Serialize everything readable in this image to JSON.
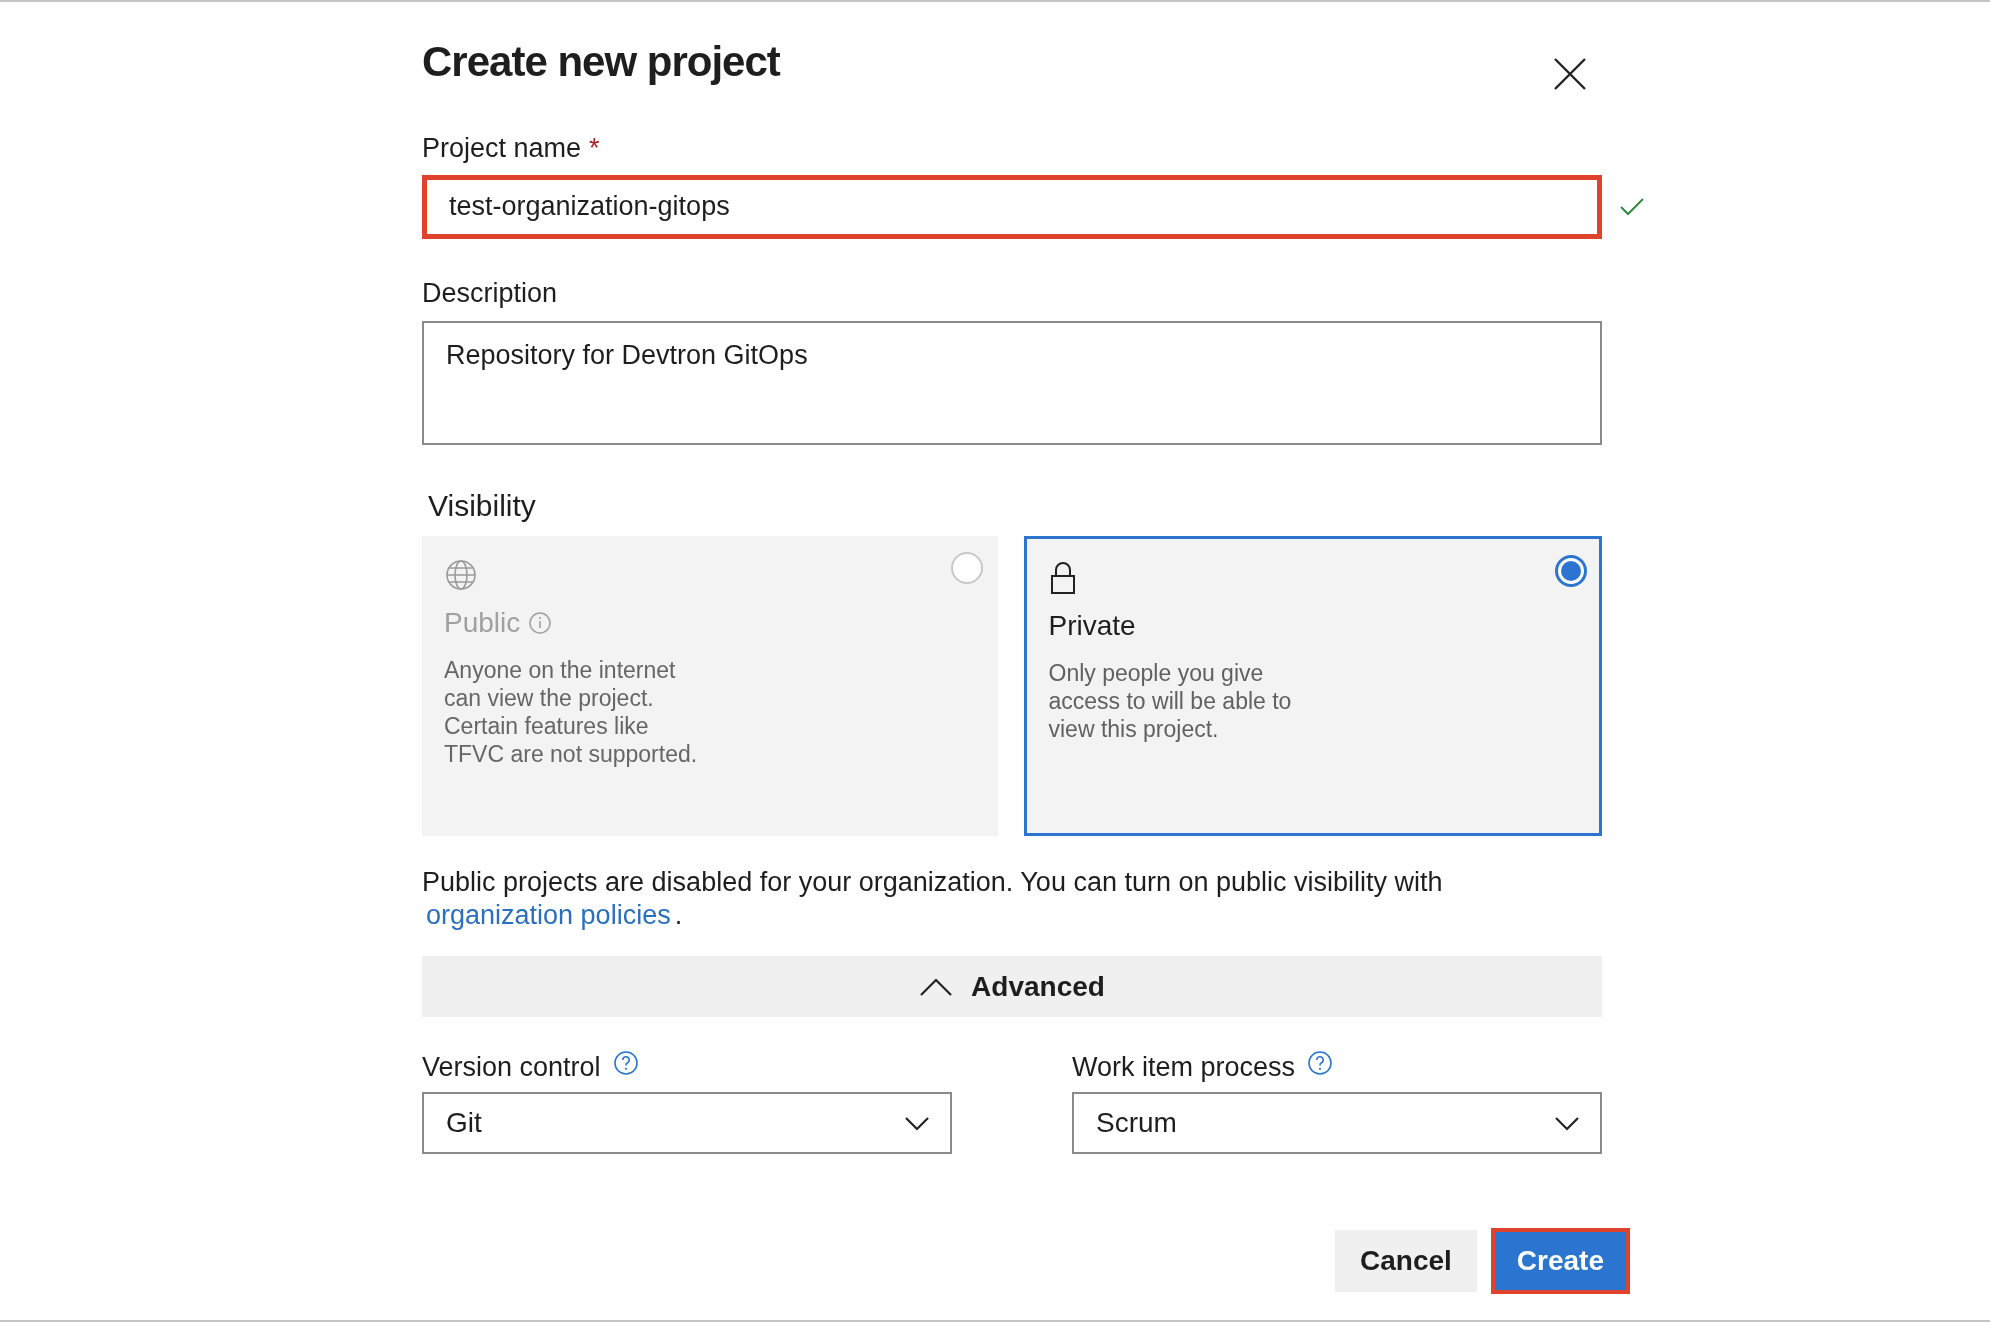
{
  "dialog": {
    "title": "Create new project"
  },
  "project_name": {
    "label": "Project name",
    "required_mark": "*",
    "value": "test-organization-gitops",
    "valid": true,
    "highlighted": true
  },
  "description": {
    "label": "Description",
    "value": "Repository for Devtron GitOps"
  },
  "visibility": {
    "label": "Visibility",
    "options": [
      {
        "kind": "public",
        "title": "Public",
        "description": "Anyone on the internet\ncan view the project.\nCertain features like\nTFVC are not supported.",
        "selected": false,
        "disabled": true
      },
      {
        "kind": "private",
        "title": "Private",
        "description": "Only people you give\naccess to will be able to\nview this project.",
        "selected": true,
        "disabled": false
      }
    ]
  },
  "notice": {
    "text": "Public projects are disabled for your organization. You can turn on public visibility with",
    "link": "organization policies",
    "end": "."
  },
  "advanced": {
    "label": "Advanced",
    "expanded": true
  },
  "selects": [
    {
      "label": "Version control",
      "value": "Git"
    },
    {
      "label": "Work item process",
      "value": "Scrum"
    }
  ],
  "buttons": [
    {
      "kind": "secondary",
      "label": "Cancel",
      "highlighted": false
    },
    {
      "kind": "primary",
      "label": "Create",
      "highlighted": true
    }
  ]
}
